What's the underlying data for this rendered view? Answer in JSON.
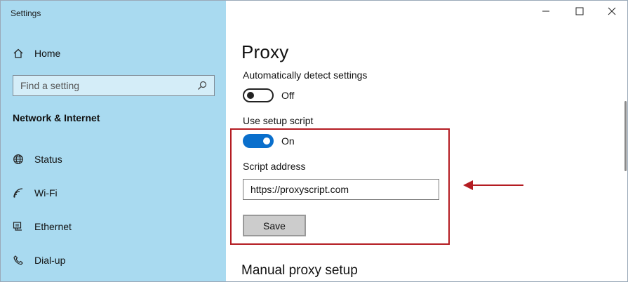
{
  "window": {
    "title": "Settings"
  },
  "sidebar": {
    "home_label": "Home",
    "search_placeholder": "Find a setting",
    "section_title": "Network & Internet",
    "items": [
      {
        "label": "Status",
        "icon": "globe-icon"
      },
      {
        "label": "Wi-Fi",
        "icon": "wifi-icon"
      },
      {
        "label": "Ethernet",
        "icon": "ethernet-icon"
      },
      {
        "label": "Dial-up",
        "icon": "phone-icon"
      }
    ]
  },
  "main": {
    "title": "Proxy",
    "auto_detect": {
      "label": "Automatically detect settings",
      "state": "Off"
    },
    "setup_script": {
      "label": "Use setup script",
      "state": "On"
    },
    "script_address": {
      "label": "Script address",
      "value": "https://proxyscript.com"
    },
    "save_label": "Save",
    "manual_title": "Manual proxy setup"
  },
  "colors": {
    "sidebar_bg": "#a9daf0",
    "toggle_on": "#0a6fcc",
    "highlight": "#b41c22"
  }
}
